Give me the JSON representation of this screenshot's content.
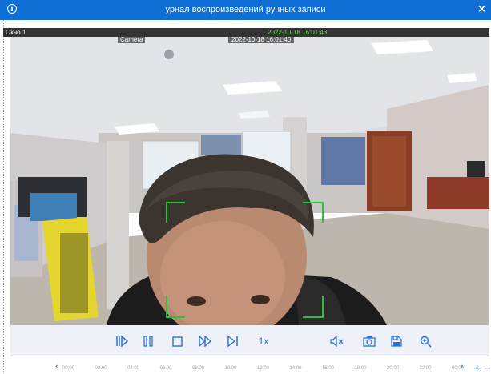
{
  "window": {
    "title": "урнал воспроизведений ручных записи",
    "close_icon": "×"
  },
  "pane": {
    "label": "Окно 1",
    "timestamp": "2022-10-18 16:01:43"
  },
  "camera": {
    "name": "Camera",
    "timestamp": "2022-10-18 16:01:40"
  },
  "controls": {
    "speed": "1x"
  },
  "timeline": {
    "prev": "‹",
    "next": "›",
    "zoom_in": "+",
    "zoom_out": "−",
    "ticks": [
      "00:00",
      "02:00",
      "04:00",
      "06:00",
      "08:00",
      "10:00",
      "12:00",
      "14:00",
      "16:00",
      "18:00",
      "20:00",
      "22:00",
      "00:00"
    ]
  },
  "colors": {
    "titlebar": "#0f6fd6",
    "accent": "#2c6fd8",
    "focus_box": "#25c43a",
    "timestamp": "#6fdc5a"
  }
}
